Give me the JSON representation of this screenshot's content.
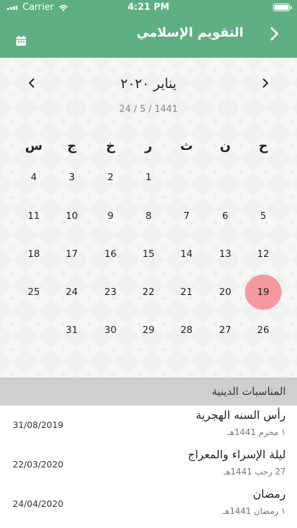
{
  "status_bar": {
    "carrier": "Carrier",
    "time": "4:21 PM",
    "battery_level": 1.0
  },
  "nav": {
    "title": "التقويم الإسلامي",
    "back_icon": "chevron-right-icon",
    "calendar_icon": "calendar-icon"
  },
  "calendar": {
    "month_title": "يناير ٢٠٢٠",
    "hijri_date": "24 / 5 / 1441",
    "weekdays": [
      "ح",
      "ن",
      "ث",
      "ر",
      "خ",
      "ج",
      "س"
    ],
    "weeks": [
      [
        "",
        "",
        "",
        "1",
        "2",
        "3",
        "4"
      ],
      [
        "5",
        "6",
        "7",
        "8",
        "9",
        "10",
        "11"
      ],
      [
        "12",
        "13",
        "14",
        "15",
        "16",
        "17",
        "18"
      ],
      [
        "19",
        "20",
        "21",
        "22",
        "23",
        "24",
        "25"
      ],
      [
        "26",
        "27",
        "28",
        "29",
        "30",
        "31",
        ""
      ]
    ],
    "selected_day": "19",
    "selected_color": "#f4999d",
    "prev_icon": "chevron-left-icon",
    "next_icon": "chevron-right-icon"
  },
  "events": {
    "header": "المناسبات الدينية",
    "items": [
      {
        "title": "رأس السنه الهجرية",
        "hijri": "١ محرم  1441هـ",
        "date": "31/08/2019"
      },
      {
        "title": "ليلة الإسراء والمعراج",
        "hijri": "27 رجب  1441هـ",
        "date": "22/03/2020"
      },
      {
        "title": "رمضان",
        "hijri": "١ رمضان  1441هـ",
        "date": "24/04/2020"
      }
    ]
  },
  "colors": {
    "header": "#5fae84",
    "section_header": "#cfcfcf"
  }
}
